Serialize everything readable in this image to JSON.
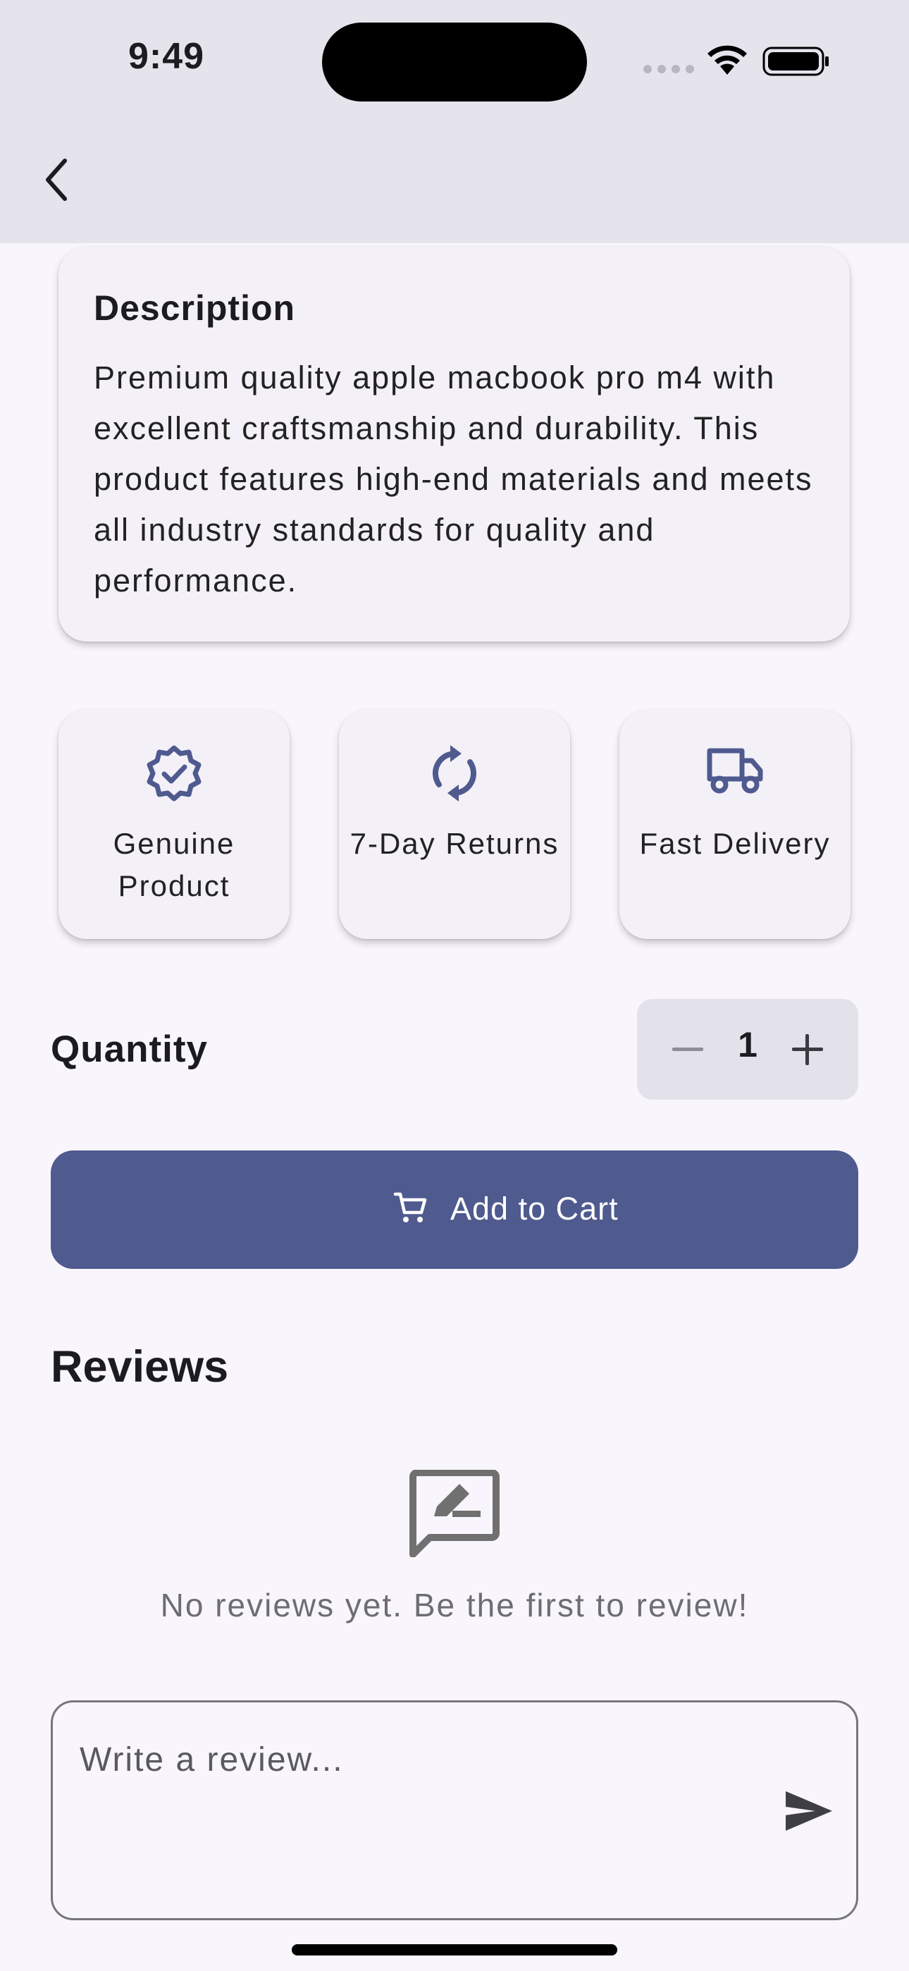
{
  "status_bar": {
    "time": "9:49"
  },
  "description": {
    "title": "Description",
    "text": "Premium quality apple macbook pro m4 with excellent craftsmanship and durability. This product features high-end materials and meets all industry standards for quality and performance."
  },
  "features": [
    {
      "icon": "verified-badge-icon",
      "label": "Genuine Product"
    },
    {
      "icon": "sync-icon",
      "label": "7-Day Returns"
    },
    {
      "icon": "truck-icon",
      "label": "Fast Delivery"
    }
  ],
  "quantity": {
    "label": "Quantity",
    "value": "1"
  },
  "cart": {
    "label": "Add to Cart"
  },
  "reviews": {
    "title": "Reviews",
    "empty_text": "No reviews yet. Be the first to review!",
    "input_placeholder": "Write a review..."
  },
  "colors": {
    "accent": "#4f5a8f",
    "app_bar": "#e5e3ec",
    "background": "#f8f6fc"
  }
}
